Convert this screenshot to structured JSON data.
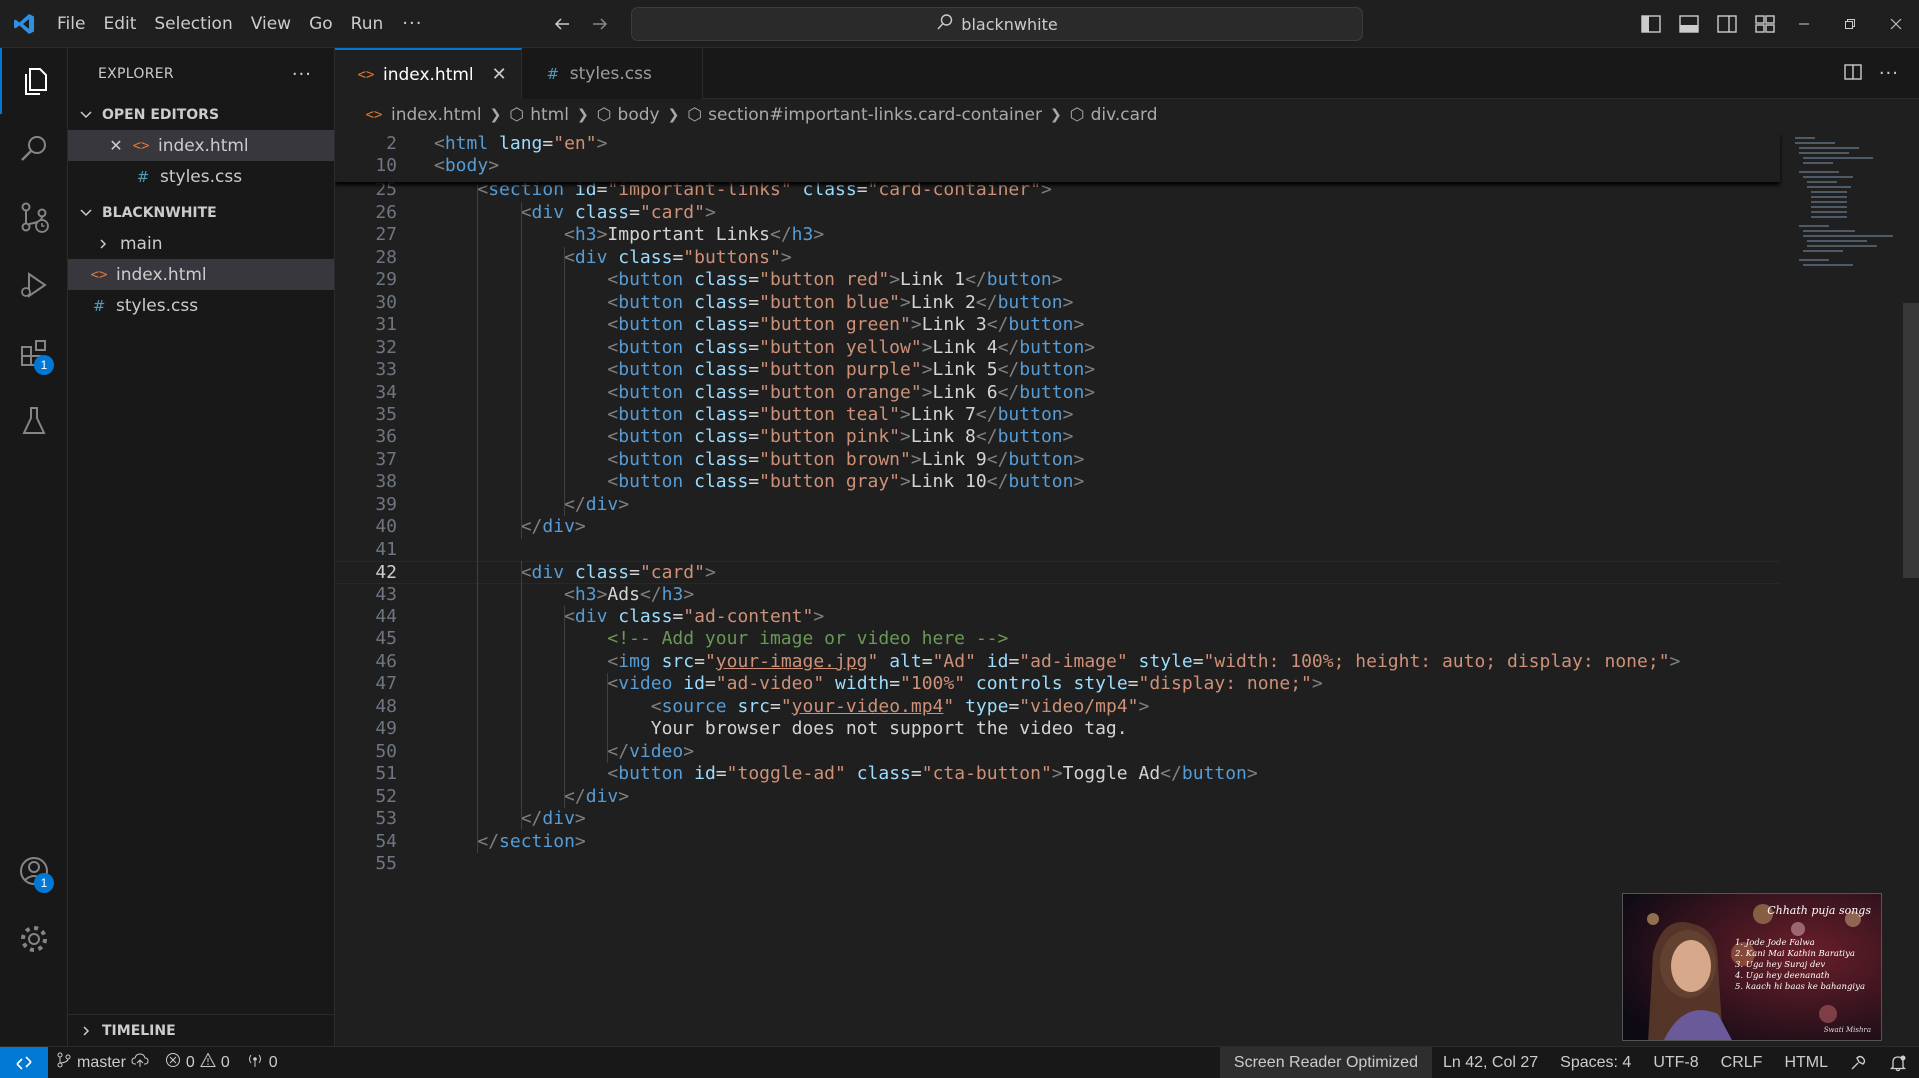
{
  "titlebar": {
    "menu": [
      "File",
      "Edit",
      "Selection",
      "View",
      "Go",
      "Run"
    ],
    "more": "···",
    "search_text": "blacknwhite"
  },
  "activity": {
    "extensions_badge": "1",
    "accounts_badge": "1"
  },
  "sidebar": {
    "title": "EXPLORER",
    "more": "···",
    "open_editors_label": "OPEN EDITORS",
    "open_editors": [
      {
        "name": "index.html",
        "type": "html"
      },
      {
        "name": "styles.css",
        "type": "css"
      }
    ],
    "folder_label": "BLACKNWHITE",
    "folder_items": [
      {
        "name": "main",
        "type": "folder"
      },
      {
        "name": "index.html",
        "type": "html"
      },
      {
        "name": "styles.css",
        "type": "css"
      }
    ],
    "timeline_label": "TIMELINE"
  },
  "tabs": [
    {
      "label": "index.html",
      "active": true
    },
    {
      "label": "styles.css",
      "active": false
    }
  ],
  "breadcrumb": [
    "index.html",
    "html",
    "body",
    "section#important-links.card-container",
    "div.card"
  ],
  "code": {
    "sticky_lines": [
      {
        "n": "2",
        "text": "<html lang=\"en\">"
      },
      {
        "n": "10",
        "text": "<body>"
      }
    ],
    "lines": [
      {
        "n": "24",
        "text": ""
      },
      {
        "n": "25",
        "text": "    <section id=\"important-links\" class=\"card-container\">"
      },
      {
        "n": "26",
        "text": "        <div class=\"card\">"
      },
      {
        "n": "27",
        "text": "            <h3>Important Links</h3>"
      },
      {
        "n": "28",
        "text": "            <div class=\"buttons\">"
      },
      {
        "n": "29",
        "text": "                <button class=\"button red\">Link 1</button>"
      },
      {
        "n": "30",
        "text": "                <button class=\"button blue\">Link 2</button>"
      },
      {
        "n": "31",
        "text": "                <button class=\"button green\">Link 3</button>"
      },
      {
        "n": "32",
        "text": "                <button class=\"button yellow\">Link 4</button>"
      },
      {
        "n": "33",
        "text": "                <button class=\"button purple\">Link 5</button>"
      },
      {
        "n": "34",
        "text": "                <button class=\"button orange\">Link 6</button>"
      },
      {
        "n": "35",
        "text": "                <button class=\"button teal\">Link 7</button>"
      },
      {
        "n": "36",
        "text": "                <button class=\"button pink\">Link 8</button>"
      },
      {
        "n": "37",
        "text": "                <button class=\"button brown\">Link 9</button>"
      },
      {
        "n": "38",
        "text": "                <button class=\"button gray\">Link 10</button>"
      },
      {
        "n": "39",
        "text": "            </div>"
      },
      {
        "n": "40",
        "text": "        </div>"
      },
      {
        "n": "41",
        "text": ""
      },
      {
        "n": "42",
        "text": "        <div class=\"card\">",
        "current": true
      },
      {
        "n": "43",
        "text": "            <h3>Ads</h3>"
      },
      {
        "n": "44",
        "text": "            <div class=\"ad-content\">"
      },
      {
        "n": "45",
        "text": "                <!-- Add your image or video here -->"
      },
      {
        "n": "46",
        "text": "                <img src=\"your-image.jpg\" alt=\"Ad\" id=\"ad-image\" style=\"width: 100%; height: auto; display: none;\">"
      },
      {
        "n": "47",
        "text": "                <video id=\"ad-video\" width=\"100%\" controls style=\"display: none;\">"
      },
      {
        "n": "48",
        "text": "                    <source src=\"your-video.mp4\" type=\"video/mp4\">"
      },
      {
        "n": "49",
        "text": "                    Your browser does not support the video tag."
      },
      {
        "n": "50",
        "text": "                </video>"
      },
      {
        "n": "51",
        "text": "                <button id=\"toggle-ad\" class=\"cta-button\">Toggle Ad</button>"
      },
      {
        "n": "52",
        "text": "            </div>"
      },
      {
        "n": "53",
        "text": "        </div>"
      },
      {
        "n": "54",
        "text": "    </section>"
      },
      {
        "n": "55",
        "text": ""
      }
    ]
  },
  "thumbnail": {
    "title": "Chhath puja songs",
    "songs": [
      "1. Jode Jode Falwa",
      "2. Kani Mai Kathin Baratiya",
      "3. Uga hey Suraj dev",
      "4. Uga hey deenanath",
      "5. kaach hi baas ke bahangiya"
    ],
    "credit": "Swati Mishra"
  },
  "statusbar": {
    "branch": "master",
    "errors": "0",
    "warnings": "0",
    "ports": "0",
    "screen_reader": "Screen Reader Optimized",
    "position": "Ln 42, Col 27",
    "spaces": "Spaces: 4",
    "encoding": "UTF-8",
    "eol": "CRLF",
    "language": "HTML"
  },
  "colors": {
    "accent": "#0078d4",
    "tag": "#569cd6",
    "attribute": "#9cdcfe",
    "string": "#ce9178",
    "comment": "#6a9955"
  }
}
